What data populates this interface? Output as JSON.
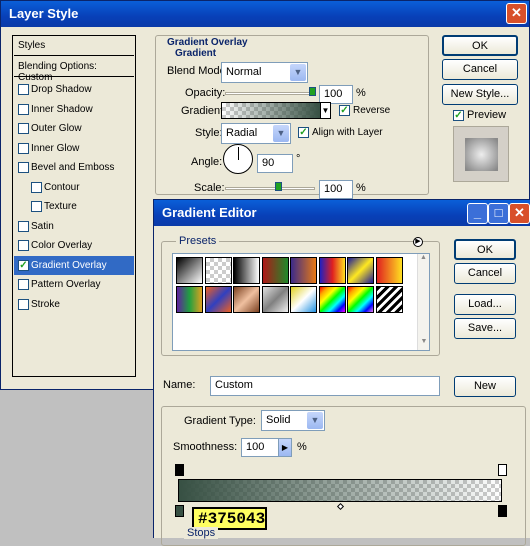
{
  "layer_style": {
    "title": "Layer Style",
    "styles_header": "Styles",
    "blending_options": "Blending Options: Custom",
    "effects": [
      {
        "label": "Drop Shadow",
        "checked": false,
        "indent": false,
        "selected": false
      },
      {
        "label": "Inner Shadow",
        "checked": false,
        "indent": false,
        "selected": false
      },
      {
        "label": "Outer Glow",
        "checked": false,
        "indent": false,
        "selected": false
      },
      {
        "label": "Inner Glow",
        "checked": false,
        "indent": false,
        "selected": false
      },
      {
        "label": "Bevel and Emboss",
        "checked": false,
        "indent": false,
        "selected": false
      },
      {
        "label": "Contour",
        "checked": false,
        "indent": true,
        "selected": false
      },
      {
        "label": "Texture",
        "checked": false,
        "indent": true,
        "selected": false
      },
      {
        "label": "Satin",
        "checked": false,
        "indent": false,
        "selected": false
      },
      {
        "label": "Color Overlay",
        "checked": false,
        "indent": false,
        "selected": false
      },
      {
        "label": "Gradient Overlay",
        "checked": true,
        "indent": false,
        "selected": true
      },
      {
        "label": "Pattern Overlay",
        "checked": false,
        "indent": false,
        "selected": false
      },
      {
        "label": "Stroke",
        "checked": false,
        "indent": false,
        "selected": false
      }
    ],
    "panel_title": "Gradient Overlay",
    "group_title": "Gradient",
    "blend_mode_label": "Blend Mode:",
    "blend_mode_value": "Normal",
    "opacity_label": "Opacity:",
    "opacity_value": "100",
    "percent": "%",
    "gradient_label": "Gradient:",
    "reverse_label": "Reverse",
    "reverse_checked": true,
    "style_label": "Style:",
    "style_value": "Radial",
    "align_label": "Align with Layer",
    "align_checked": true,
    "angle_label": "Angle:",
    "angle_value": "90",
    "degree": "°",
    "scale_label": "Scale:",
    "scale_value": "100",
    "ok": "OK",
    "cancel": "Cancel",
    "new_style": "New Style...",
    "preview_label": "Preview",
    "preview_checked": true
  },
  "gradient_editor": {
    "title": "Gradient Editor",
    "presets_label": "Presets",
    "ok": "OK",
    "cancel": "Cancel",
    "load": "Load...",
    "save": "Save...",
    "name_label": "Name:",
    "name_value": "Custom",
    "new_button": "New",
    "type_label": "Gradient Type:",
    "type_value": "Solid",
    "smoothness_label": "Smoothness:",
    "smoothness_value": "100",
    "percent": "%",
    "color_tooltip": "#375043",
    "stops_label": "Stops",
    "start_color": "#375043"
  }
}
